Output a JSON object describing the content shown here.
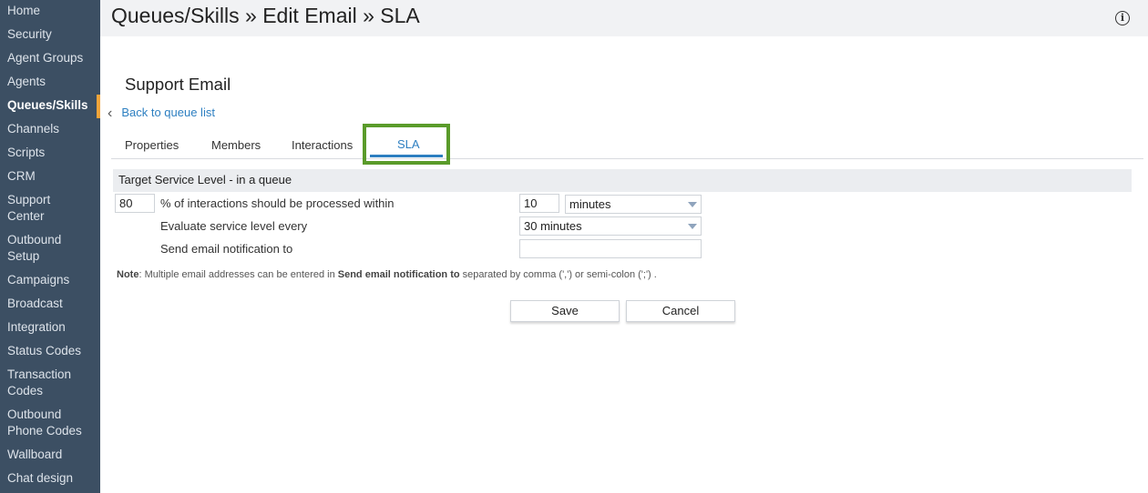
{
  "sidebar": {
    "items": [
      {
        "label": "Home"
      },
      {
        "label": "Security"
      },
      {
        "label": "Agent Groups"
      },
      {
        "label": "Agents"
      },
      {
        "label": "Queues/Skills",
        "active": true
      },
      {
        "label": "Channels"
      },
      {
        "label": "Scripts"
      },
      {
        "label": "CRM"
      },
      {
        "label": "Support",
        "label2": "Center"
      },
      {
        "label": "Outbound",
        "label2": "Setup"
      },
      {
        "label": "Campaigns"
      },
      {
        "label": "Broadcast"
      },
      {
        "label": "Integration"
      },
      {
        "label": "Status Codes"
      },
      {
        "label": "Transaction",
        "label2": "Codes"
      },
      {
        "label": "Outbound",
        "label2": "Phone Codes"
      },
      {
        "label": "Wallboard"
      },
      {
        "label": "Chat design"
      }
    ]
  },
  "header": {
    "title": "Queues/Skills » Edit Email » SLA",
    "info_icon": "info-icon",
    "info_glyph": "i"
  },
  "entity_name": "Support Email",
  "back_link": {
    "label": "Back to queue list",
    "glyph": "‹"
  },
  "tabs": {
    "properties": "Properties",
    "members": "Members",
    "interactions": "Interactions",
    "sla": "SLA",
    "active": "SLA"
  },
  "section": {
    "title": "Target Service Level - in a queue"
  },
  "form": {
    "percent_value": "80",
    "percent_label": "% of interactions should be processed within",
    "time_value": "10",
    "time_unit": "minutes",
    "evaluate_label": "Evaluate service level every",
    "evaluate_value": "30 minutes",
    "notify_label": "Send email notification to",
    "notify_value": ""
  },
  "note": {
    "prefix": "Note",
    "text1": ": Multiple email addresses can be entered in ",
    "field": "Send email notification to",
    "text2": " separated by comma (',') or semi-colon (';') ."
  },
  "buttons": {
    "save": "Save",
    "cancel": "Cancel"
  },
  "colors": {
    "sidebar_bg": "#3c4f63",
    "active_marker": "#f0a43a",
    "link": "#2d7fc1",
    "highlight_box": "#5a9b2a"
  }
}
